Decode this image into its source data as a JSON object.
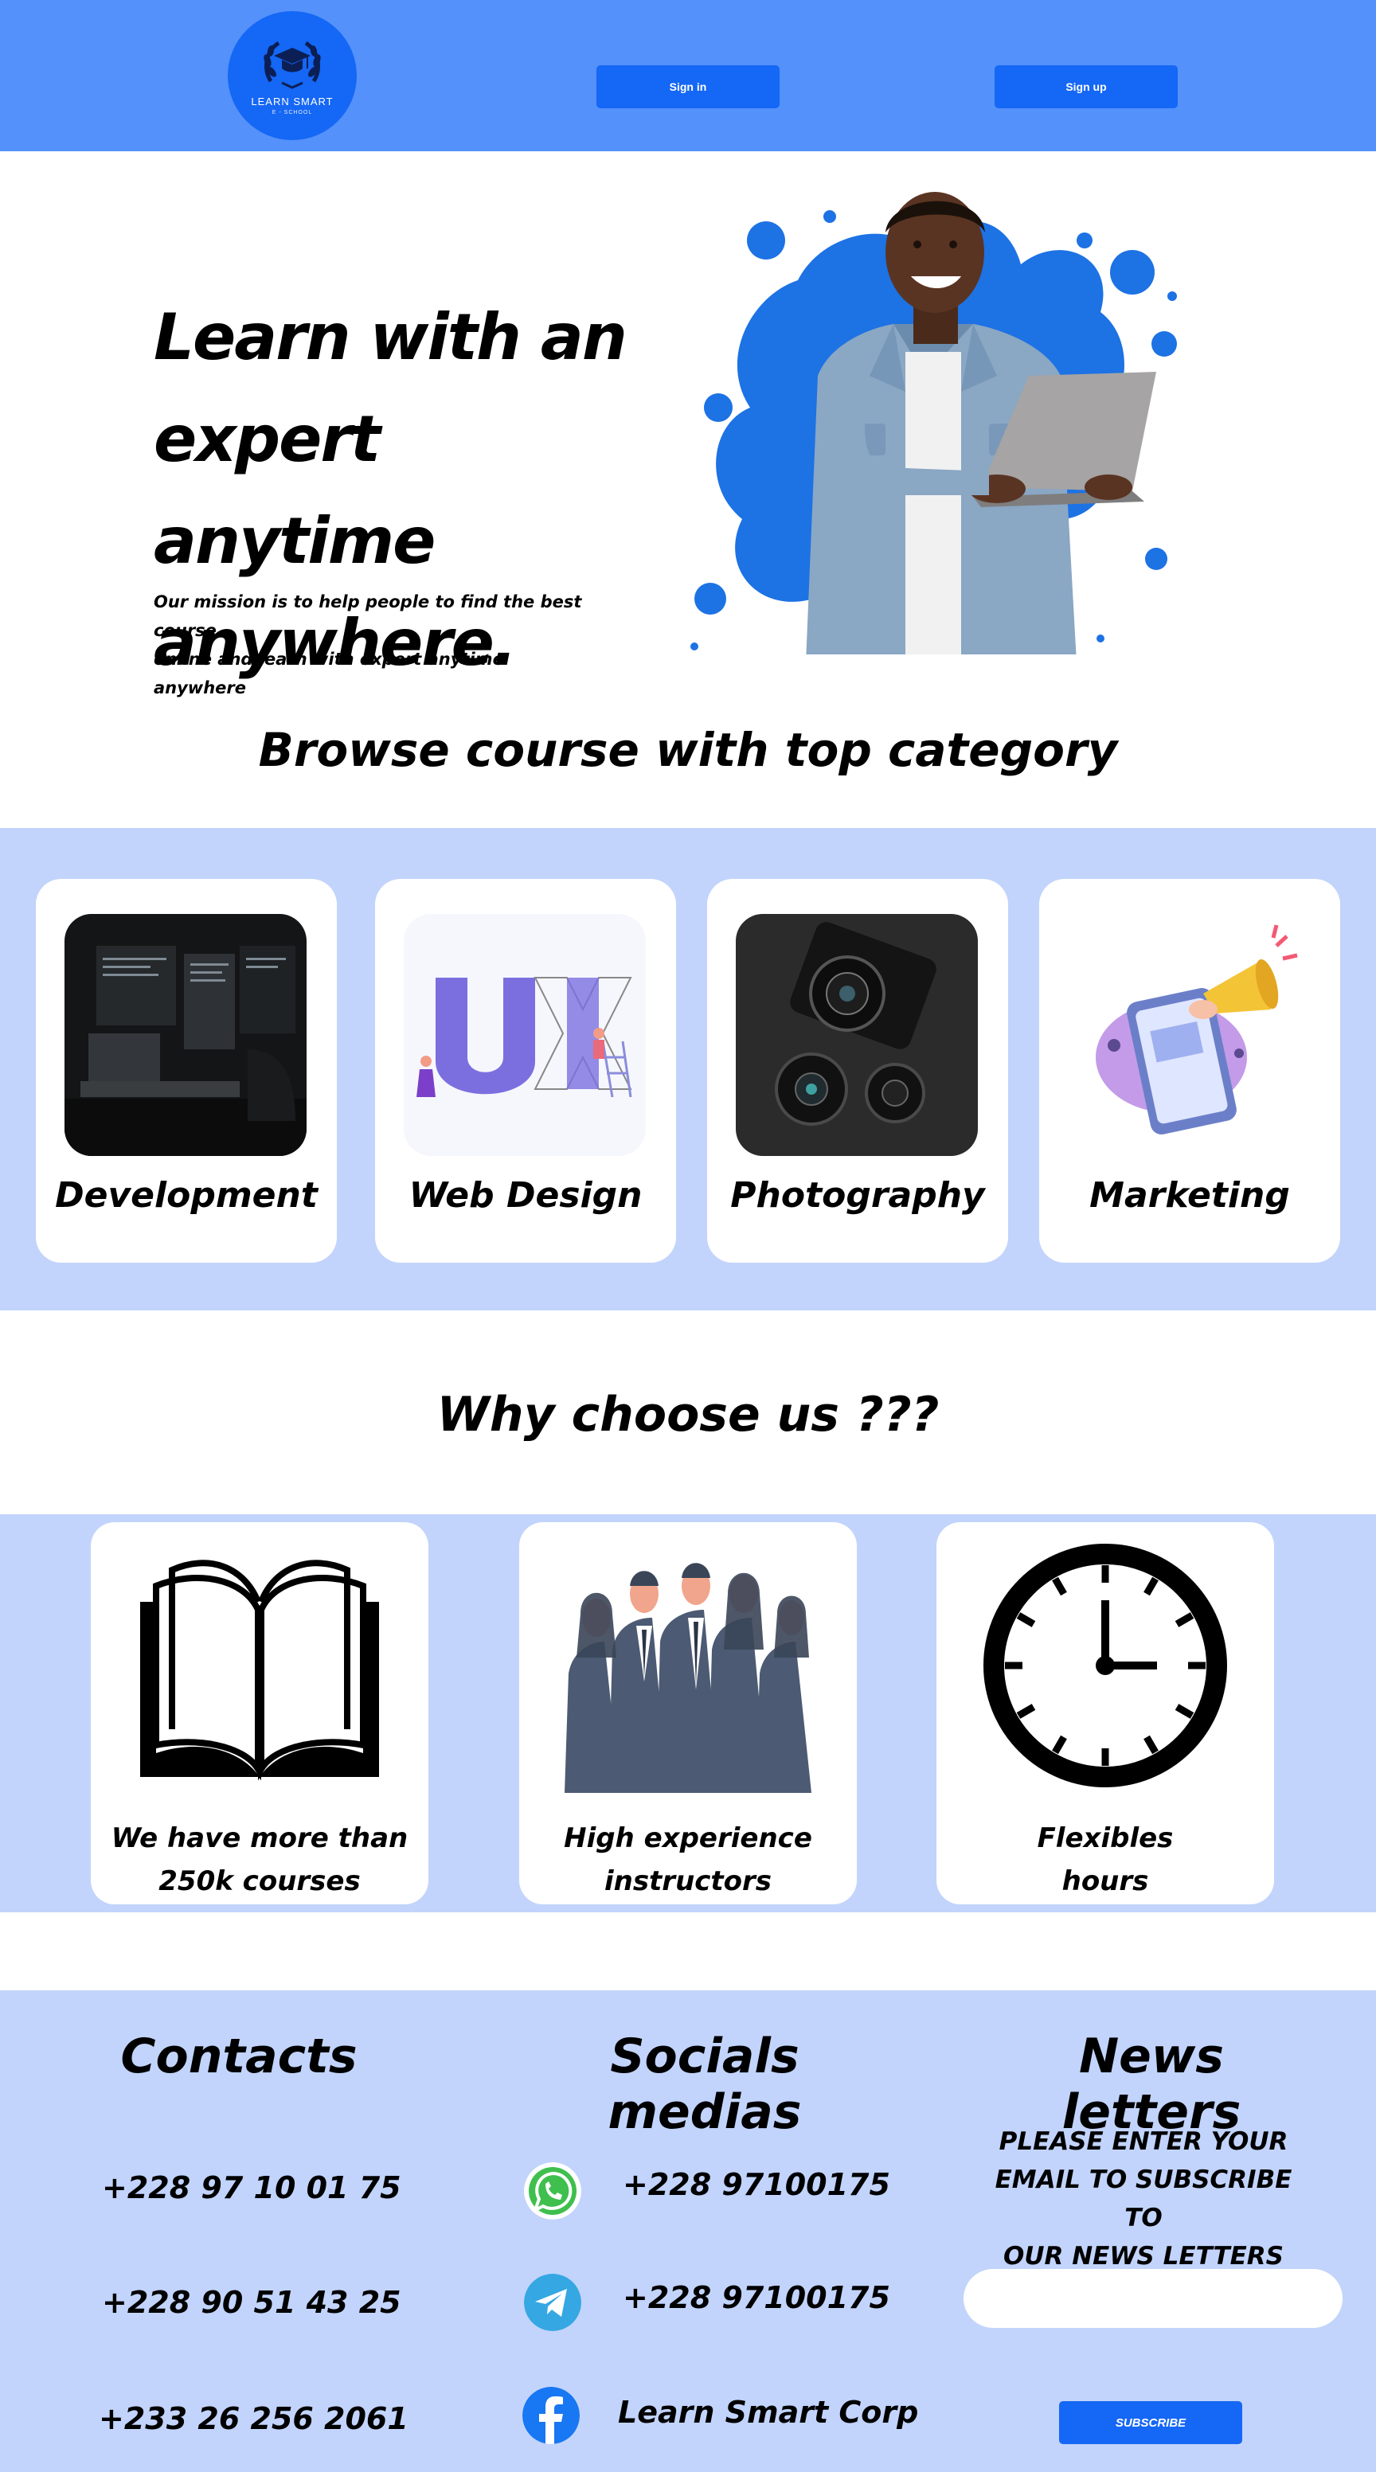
{
  "header": {
    "logo_name": "LEARN SMART",
    "logo_sub": "E - SCHOOL",
    "signin_label": "Sign in",
    "signup_label": "Sign up"
  },
  "hero": {
    "title_line1": "Learn with an",
    "title_line2": "expert anytime",
    "title_line3": "anywhere.",
    "subtitle_line1": "Our mission is to help people to find the  best course",
    "subtitle_line2": "online and learn with expert anytime anywhere"
  },
  "browse": {
    "title": "Browse course with top category",
    "categories": [
      {
        "label": "Development"
      },
      {
        "label": "Web Design"
      },
      {
        "label": "Photography"
      },
      {
        "label": "Marketing"
      }
    ]
  },
  "why": {
    "title": "Why choose us ???",
    "items": [
      {
        "line1": "We have more than",
        "line2": "250k courses",
        "icon": "book-icon"
      },
      {
        "line1": "High experience",
        "line2": "instructors",
        "icon": "team-icon"
      },
      {
        "line1": "Flexibles",
        "line2": "hours",
        "icon": "clock-icon"
      }
    ]
  },
  "footer": {
    "contacts_title": "Contacts",
    "contacts": [
      "+228 97 10 01 75",
      "+228 90 51 43 25",
      "+233 26 256 2061"
    ],
    "socials_title": "Socials medias",
    "socials": [
      {
        "icon": "whatsapp-icon",
        "text": "+228 97100175"
      },
      {
        "icon": "telegram-icon",
        "text": "+228 97100175"
      },
      {
        "icon": "facebook-icon",
        "text": "Learn Smart Corp"
      }
    ],
    "news_title": "News letters",
    "news_desc_line1": "PLEASE ENTER YOUR",
    "news_desc_line2": "EMAIL TO SUBSCRIBE TO",
    "news_desc_line3": "OUR NEWS LETTERS",
    "email_value": "",
    "subscribe_label": "SUBSCRIBE"
  },
  "colors": {
    "header_bg": "#5491fb",
    "primary_button": "#1567f5",
    "band_bg": "#c2d4fc"
  }
}
